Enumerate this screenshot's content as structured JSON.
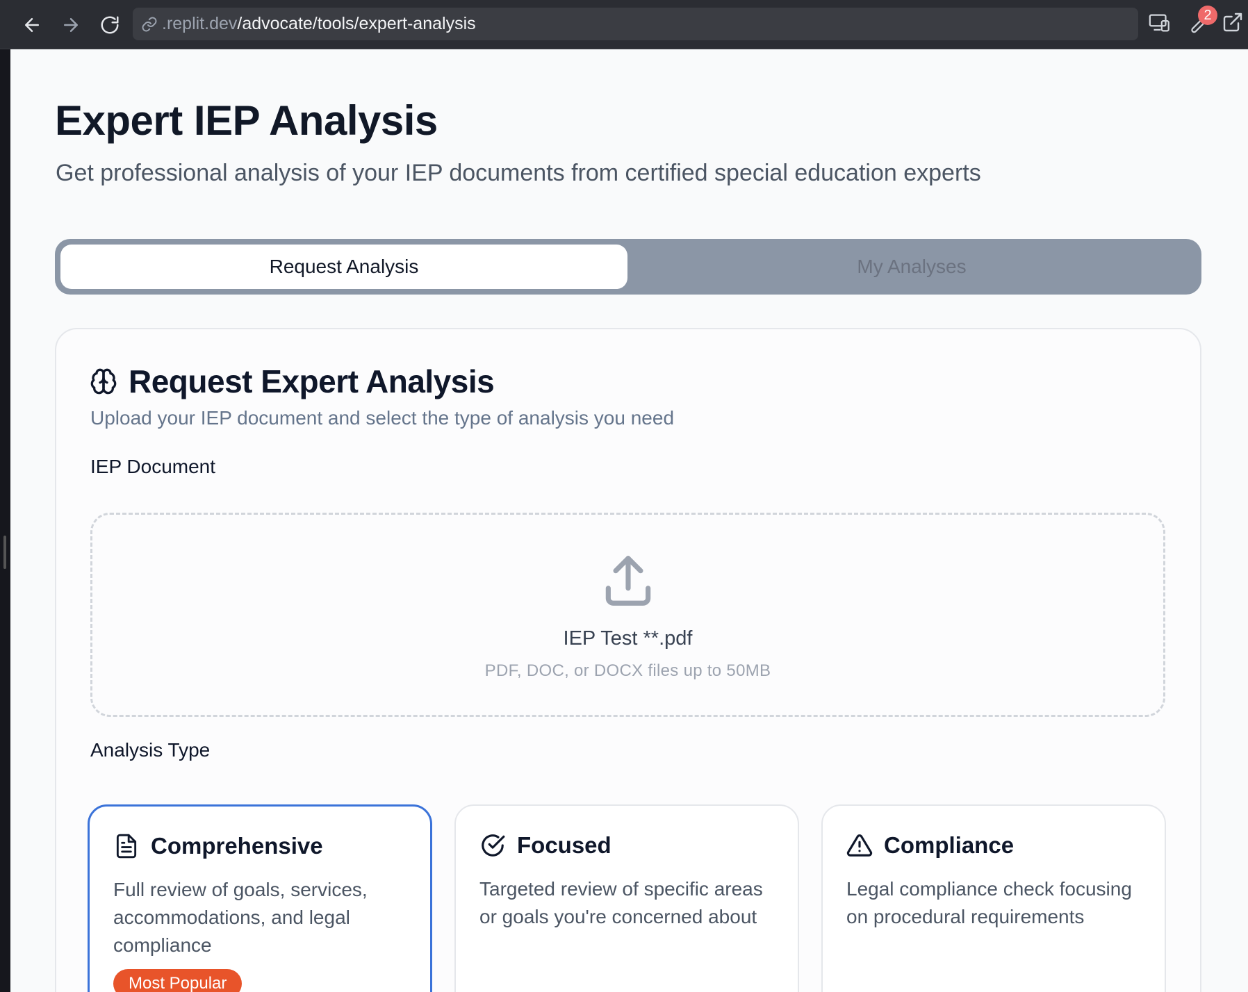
{
  "browser": {
    "url_host": ".replit.dev",
    "url_path": "/advocate/tools/expert-analysis",
    "notification_count": "2"
  },
  "page": {
    "title": "Expert IEP Analysis",
    "subtitle": "Get professional analysis of your IEP documents from certified special education experts"
  },
  "tabs": [
    {
      "label": "Request Analysis",
      "active": true
    },
    {
      "label": "My Analyses",
      "active": false
    }
  ],
  "card": {
    "title": "Request Expert Analysis",
    "description": "Upload your IEP document and select the type of analysis you need",
    "icon": "brain-icon"
  },
  "document": {
    "label": "IEP Document",
    "file_name": "IEP Test **.pdf",
    "hint": "PDF, DOC, or DOCX files up to 50MB",
    "icon": "upload-icon"
  },
  "analysis_type": {
    "label": "Analysis Type",
    "options": [
      {
        "title": "Comprehensive",
        "description": "Full review of goals, services, accommodations, and legal compliance",
        "badge": "Most Popular",
        "icon": "document-icon",
        "selected": true
      },
      {
        "title": "Focused",
        "description": "Targeted review of specific areas or goals you're concerned about",
        "icon": "check-circle-icon",
        "selected": false
      },
      {
        "title": "Compliance",
        "description": "Legal compliance check focusing on procedural requirements",
        "icon": "warning-triangle-icon",
        "selected": false
      }
    ]
  },
  "colors": {
    "accent": "#3b73d9",
    "badge": "#e8542a",
    "tab_track": "#8b96a6"
  }
}
